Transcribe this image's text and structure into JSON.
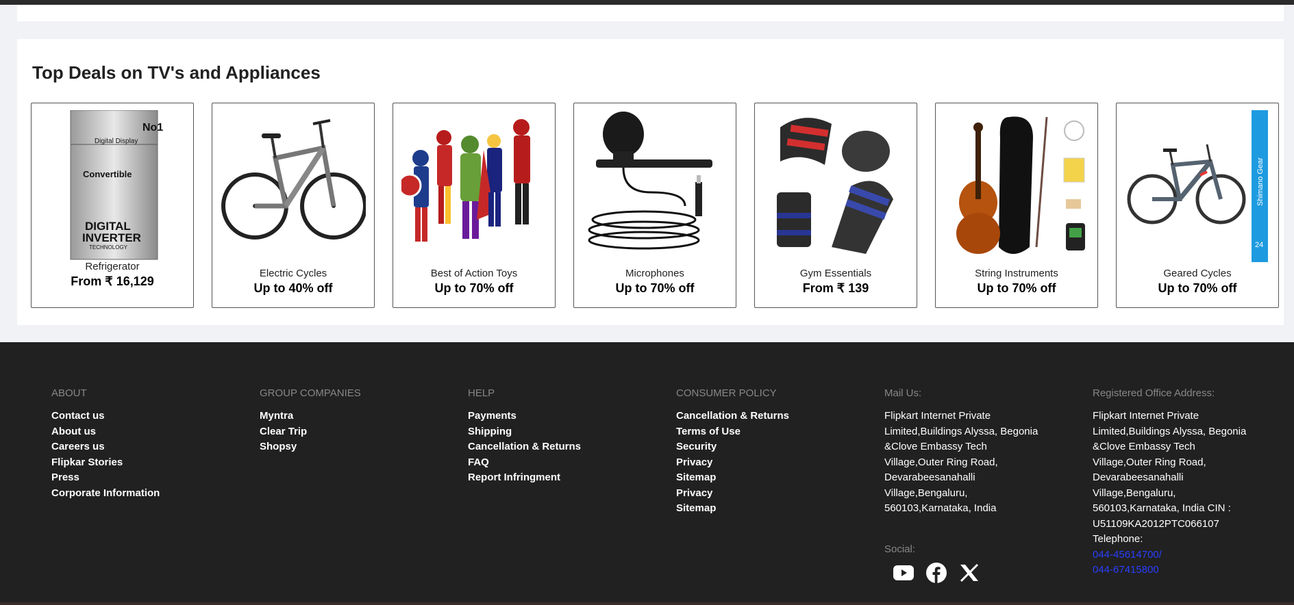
{
  "deals": {
    "title": "Top Deals on TV's and Appliances",
    "items": [
      {
        "name": "Refrigerator",
        "price": "From ₹ 16,129"
      },
      {
        "name": "Electric Cycles",
        "price": "Up to 40% off"
      },
      {
        "name": "Best of Action Toys",
        "price": "Up to 70% off"
      },
      {
        "name": "Microphones",
        "price": "Up to 70% off"
      },
      {
        "name": "Gym Essentials",
        "price": "From ₹ 139"
      },
      {
        "name": "String Instruments",
        "price": "Up to 70% off"
      },
      {
        "name": "Geared Cycles",
        "price": "Up to 70% off"
      }
    ],
    "fridge_text": {
      "badge": "No1",
      "display": "Digital Display",
      "conv": "Convertible",
      "inv1": "DIGITAL",
      "inv2": "INVERTER",
      "inv3": "TECHNOLOGY"
    },
    "cycle_banner": "Shimano Gear",
    "cycle_badge": "24"
  },
  "footer": {
    "about": {
      "heading": "ABOUT",
      "links": [
        "Contact us",
        "About us",
        "Careers us",
        "Flipkar Stories",
        "Press",
        "Corporate Information"
      ]
    },
    "group": {
      "heading": "GROUP COMPANIES",
      "links": [
        "Myntra",
        "Clear Trip",
        "Shopsy"
      ]
    },
    "help": {
      "heading": "HELP",
      "links": [
        "Payments",
        "Shipping",
        "Cancellation & Returns",
        "FAQ",
        "Report Infringment"
      ]
    },
    "policy": {
      "heading": "CONSUMER POLICY",
      "links": [
        "Cancellation & Returns",
        "Terms of Use",
        "Security",
        "Privacy",
        "Sitemap",
        "Privacy",
        "Sitemap"
      ]
    },
    "mail": {
      "heading": "Mail Us:",
      "lines": [
        "Flipkart Internet Private",
        "Limited,Buildings Alyssa, Begonia",
        "&Clove Embassy Tech",
        "Village,Outer Ring Road,",
        "Devarabeesanahalli",
        "Village,Bengaluru,",
        "560103,Karnataka, India"
      ]
    },
    "office": {
      "heading": "Registered Office Address:",
      "lines": [
        "Flipkart Internet Private",
        "Limited,Buildings Alyssa, Begonia",
        "&Clove Embassy Tech",
        "Village,Outer Ring Road,",
        "Devarabeesanahalli",
        "Village,Bengaluru,",
        "560103,Karnataka, India CIN :",
        "U51109KA2012PTC066107",
        "Telephone:"
      ],
      "phones": [
        "044-45614700/",
        "044-67415800"
      ]
    },
    "social": {
      "heading": "Social:",
      "icons": [
        "youtube-icon",
        "facebook-icon",
        "x-icon"
      ]
    }
  }
}
